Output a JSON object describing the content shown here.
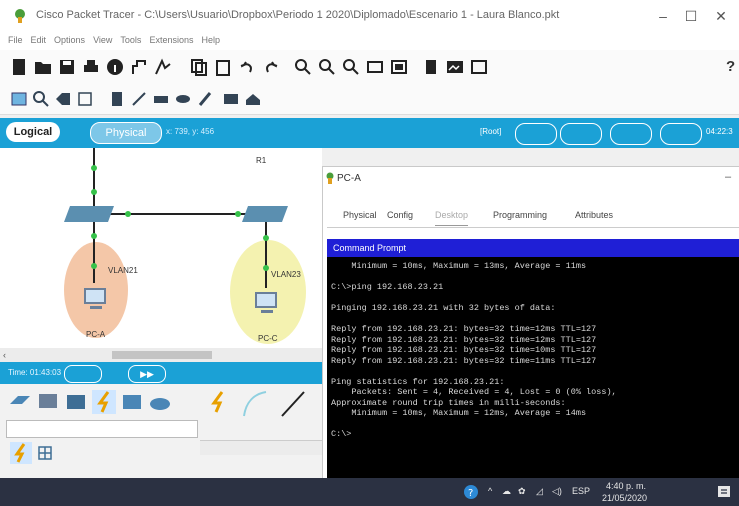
{
  "window": {
    "title": "Cisco Packet Tracer - C:\\Users\\Usuario\\Dropbox\\Periodo 1 2020\\Diplomado\\Escenario 1 - Laura Blanco.pkt",
    "minimize": "–",
    "maximize": "☐",
    "close": "✕"
  },
  "menu": [
    "File",
    "Edit",
    "Options",
    "View",
    "Tools",
    "Extensions",
    "Help"
  ],
  "toolbar": {
    "help": "?"
  },
  "workspace": {
    "logical_tab": "Logical",
    "physical_tab": "Physical",
    "coords": "x: 739, y: 456",
    "mode": "[Root]",
    "clock": "04:22:3"
  },
  "topology": {
    "router_label": "R1",
    "vlan_a": "VLAN21",
    "vlan_b": "VLAN23",
    "pc_a": "PC-A",
    "pc_c": "PC-C"
  },
  "simulation": {
    "time": "Time: 01:43:03"
  },
  "pc_window": {
    "title": "PC-A",
    "tabs": [
      "Physical",
      "Config",
      "Desktop",
      "Programming",
      "Attributes"
    ],
    "active_tab": "Desktop",
    "panel_title": "Command Prompt",
    "terminal_lines": [
      "    Minimum = 10ms, Maximum = 13ms, Average = 11ms",
      "",
      "C:\\>ping 192.168.23.21",
      "",
      "Pinging 192.168.23.21 with 32 bytes of data:",
      "",
      "Reply from 192.168.23.21: bytes=32 time=12ms TTL=127",
      "Reply from 192.168.23.21: bytes=32 time=12ms TTL=127",
      "Reply from 192.168.23.21: bytes=32 time=10ms TTL=127",
      "Reply from 192.168.23.21: bytes=32 time=11ms TTL=127",
      "",
      "Ping statistics for 192.168.23.21:",
      "    Packets: Sent = 4, Received = 4, Lost = 0 (0% loss),",
      "Approximate round trip times in milli-seconds:",
      "    Minimum = 10ms, Maximum = 12ms, Average = 14ms",
      "",
      "C:\\>"
    ]
  },
  "taskbar": {
    "lang": "ESP",
    "time": "4:40 p. m.",
    "date": "21/05/2020"
  }
}
